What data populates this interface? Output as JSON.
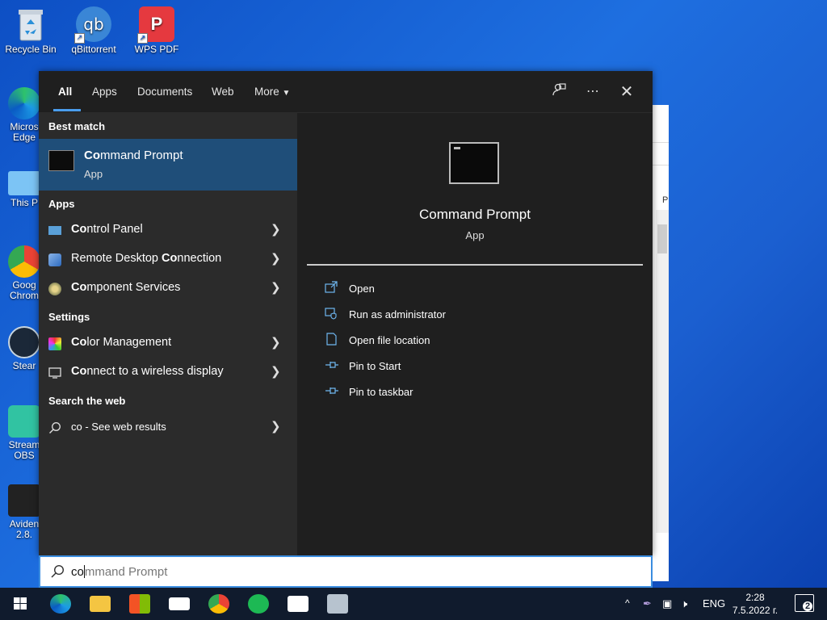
{
  "desktop": {
    "top_icons": [
      {
        "name": "recycle-bin-icon",
        "label": "Recycle Bin"
      },
      {
        "name": "qbittorrent-icon",
        "label": "qBittorrent"
      },
      {
        "name": "wps-pdf-icon",
        "label": "WPS PDF"
      }
    ],
    "left_icons": [
      {
        "name": "edge-icon",
        "label": "Micros\nEdge"
      },
      {
        "name": "this-pc-icon",
        "label": "This P"
      },
      {
        "name": "chrome-icon",
        "label": "Goog\nChrom"
      },
      {
        "name": "steam-icon",
        "label": "Stear"
      },
      {
        "name": "streamlabs-obs-icon",
        "label": "Stream\nOBS"
      },
      {
        "name": "avidemux-icon",
        "label": "Aviden\n2.8."
      }
    ],
    "bg_window_label": "P"
  },
  "search_panel": {
    "tabs": [
      {
        "label": "All",
        "active": true
      },
      {
        "label": "Apps"
      },
      {
        "label": "Documents"
      },
      {
        "label": "Web"
      },
      {
        "label": "More"
      }
    ],
    "best_match_heading": "Best match",
    "best_match": {
      "title_bold": "Co",
      "title_rest": "mmand Prompt",
      "subtitle": "App"
    },
    "apps_heading": "Apps",
    "apps": [
      {
        "bold": "Co",
        "rest": "ntrol Panel",
        "icon": "control-panel-icon"
      },
      {
        "pre": "Remote Desktop ",
        "bold": "Co",
        "rest": "nnection",
        "icon": "remote-desktop-icon"
      },
      {
        "bold": "Co",
        "rest": "mponent Services",
        "icon": "component-services-icon"
      }
    ],
    "settings_heading": "Settings",
    "settings": [
      {
        "bold": "Co",
        "rest": "lor Management",
        "icon": "color-management-icon"
      },
      {
        "pre": "",
        "bold": "Co",
        "rest": "nnect to a wireless display",
        "icon": "display-icon"
      }
    ],
    "web_heading": "Search the web",
    "web_result": {
      "query": "co",
      "suffix": " - See web results"
    },
    "preview": {
      "title": "Command Prompt",
      "subtitle": "App",
      "actions": [
        {
          "label": "Open",
          "icon": "open-icon"
        },
        {
          "label": "Run as administrator",
          "icon": "shield-icon"
        },
        {
          "label": "Open file location",
          "icon": "folder-icon"
        },
        {
          "label": "Pin to Start",
          "icon": "pin-icon"
        },
        {
          "label": "Pin to taskbar",
          "icon": "pin-icon"
        }
      ]
    }
  },
  "searchbox": {
    "typed": "co",
    "suggestion": "mmand Prompt"
  },
  "taskbar": {
    "language": "ENG",
    "time": "2:28",
    "date": "7.5.2022 г.",
    "notification_count": "2"
  }
}
